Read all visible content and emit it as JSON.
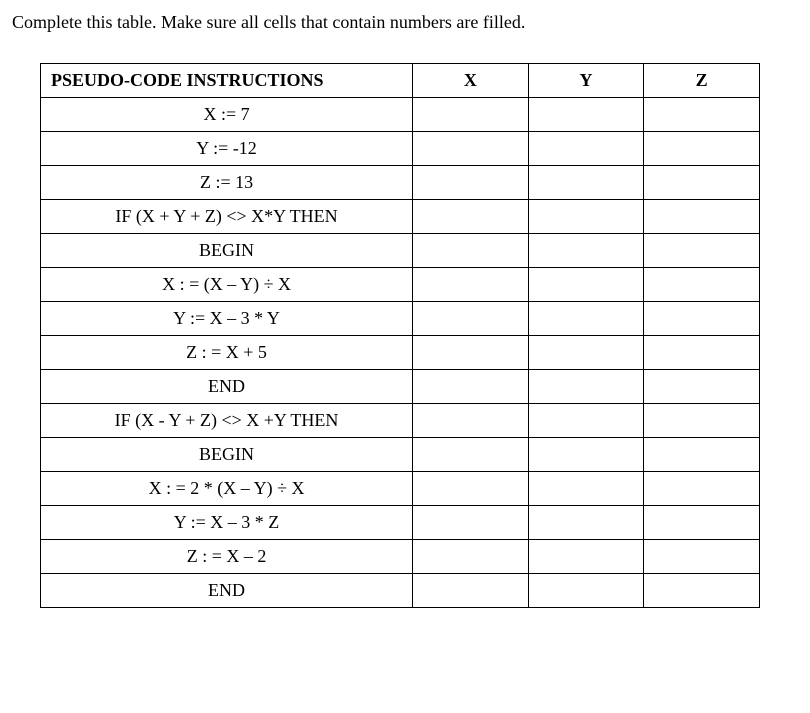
{
  "prompt": "Complete this table. Make sure all cells that contain numbers are filled.",
  "headers": {
    "instructions": "PSEUDO-CODE INSTRUCTIONS",
    "x": "X",
    "y": "Y",
    "z": "Z"
  },
  "rows": [
    {
      "instr": "X := 7",
      "x": "",
      "y": "",
      "z": ""
    },
    {
      "instr": "Y := -12",
      "x": "",
      "y": "",
      "z": ""
    },
    {
      "instr": "Z := 13",
      "x": "",
      "y": "",
      "z": ""
    },
    {
      "instr": "IF (X + Y + Z) <> X*Y THEN",
      "x": "",
      "y": "",
      "z": ""
    },
    {
      "instr": "BEGIN",
      "x": "",
      "y": "",
      "z": ""
    },
    {
      "instr": "X : = (X – Y) ÷ X",
      "x": "",
      "y": "",
      "z": ""
    },
    {
      "instr": "Y := X – 3 * Y",
      "x": "",
      "y": "",
      "z": ""
    },
    {
      "instr": "Z : = X + 5",
      "x": "",
      "y": "",
      "z": ""
    },
    {
      "instr": "END",
      "x": "",
      "y": "",
      "z": ""
    },
    {
      "instr": "IF (X - Y + Z) <> X +Y THEN",
      "x": "",
      "y": "",
      "z": ""
    },
    {
      "instr": "BEGIN",
      "x": "",
      "y": "",
      "z": ""
    },
    {
      "instr": "X : = 2 * (X – Y) ÷ X",
      "x": "",
      "y": "",
      "z": ""
    },
    {
      "instr": "Y := X – 3 * Z",
      "x": "",
      "y": "",
      "z": ""
    },
    {
      "instr": "Z : = X –  2",
      "x": "",
      "y": "",
      "z": ""
    },
    {
      "instr": "END",
      "x": "",
      "y": "",
      "z": ""
    }
  ]
}
